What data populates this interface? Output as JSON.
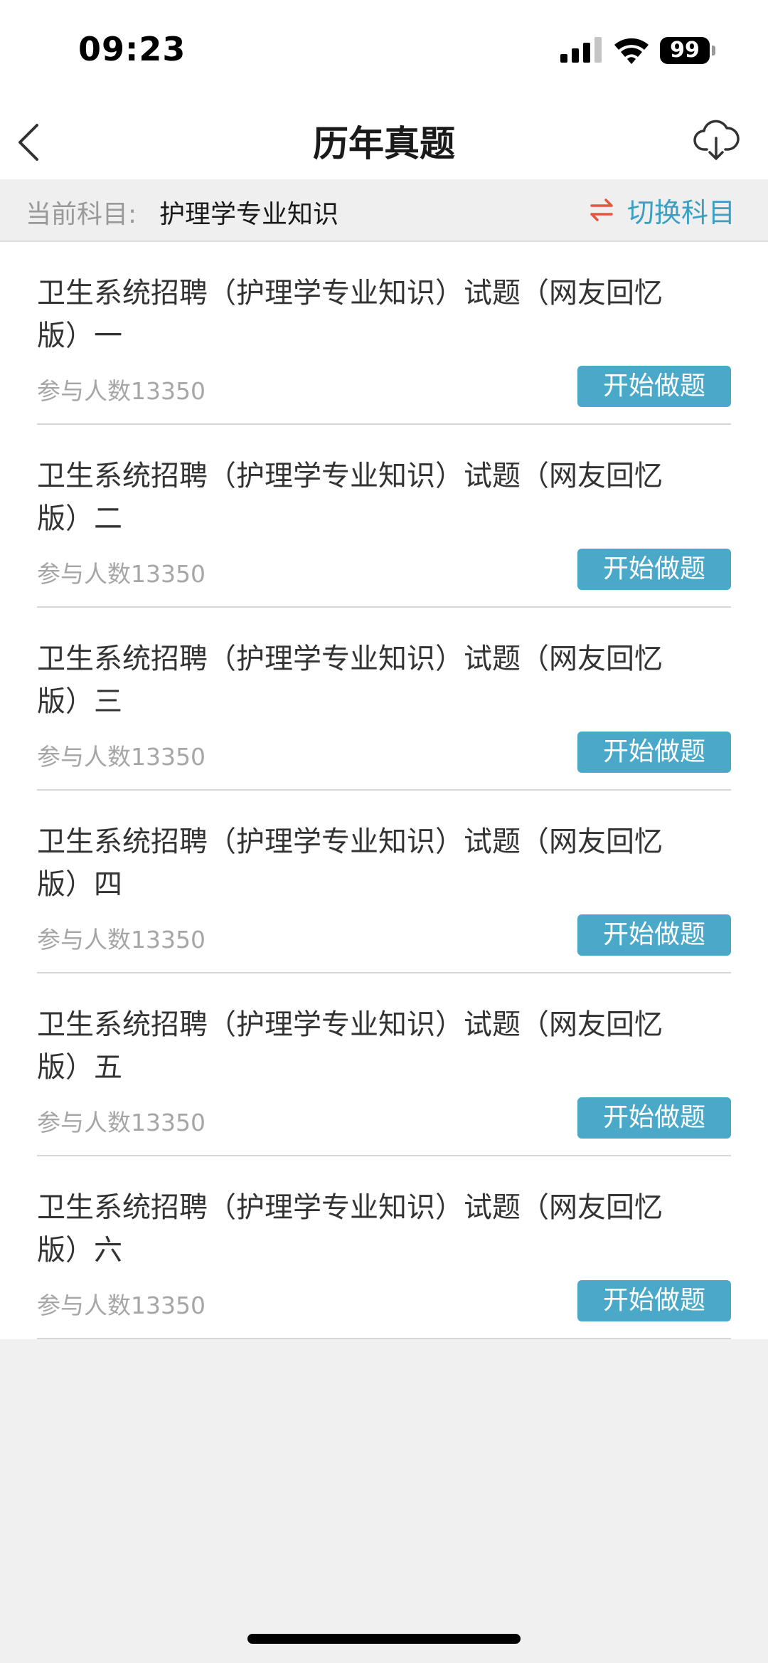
{
  "status_bar": {
    "time": "09:23",
    "battery": "99"
  },
  "nav": {
    "title": "历年真题",
    "back_icon": "chevron-left-icon",
    "download_icon": "cloud-download-icon"
  },
  "subject": {
    "label": "当前科目:",
    "value": "护理学专业知识",
    "switch_label": "切换科目",
    "switch_icon": "swap-arrows-icon",
    "switch_icon_color": "#e2573f"
  },
  "exams": [
    {
      "title": "卫生系统招聘（护理学专业知识）试题（网友回忆版）一",
      "count": "参与人数13350",
      "button": "开始做题"
    },
    {
      "title": "卫生系统招聘（护理学专业知识）试题（网友回忆版）二",
      "count": "参与人数13350",
      "button": "开始做题"
    },
    {
      "title": "卫生系统招聘（护理学专业知识）试题（网友回忆版）三",
      "count": "参与人数13350",
      "button": "开始做题"
    },
    {
      "title": "卫生系统招聘（护理学专业知识）试题（网友回忆版）四",
      "count": "参与人数13350",
      "button": "开始做题"
    },
    {
      "title": "卫生系统招聘（护理学专业知识）试题（网友回忆版）五",
      "count": "参与人数13350",
      "button": "开始做题"
    },
    {
      "title": "卫生系统招聘（护理学专业知识）试题（网友回忆版）六",
      "count": "参与人数13350",
      "button": "开始做题"
    }
  ],
  "colors": {
    "accent": "#4aa8c8",
    "switch_text": "#3a9fc3",
    "background": "#f0f0f0"
  }
}
